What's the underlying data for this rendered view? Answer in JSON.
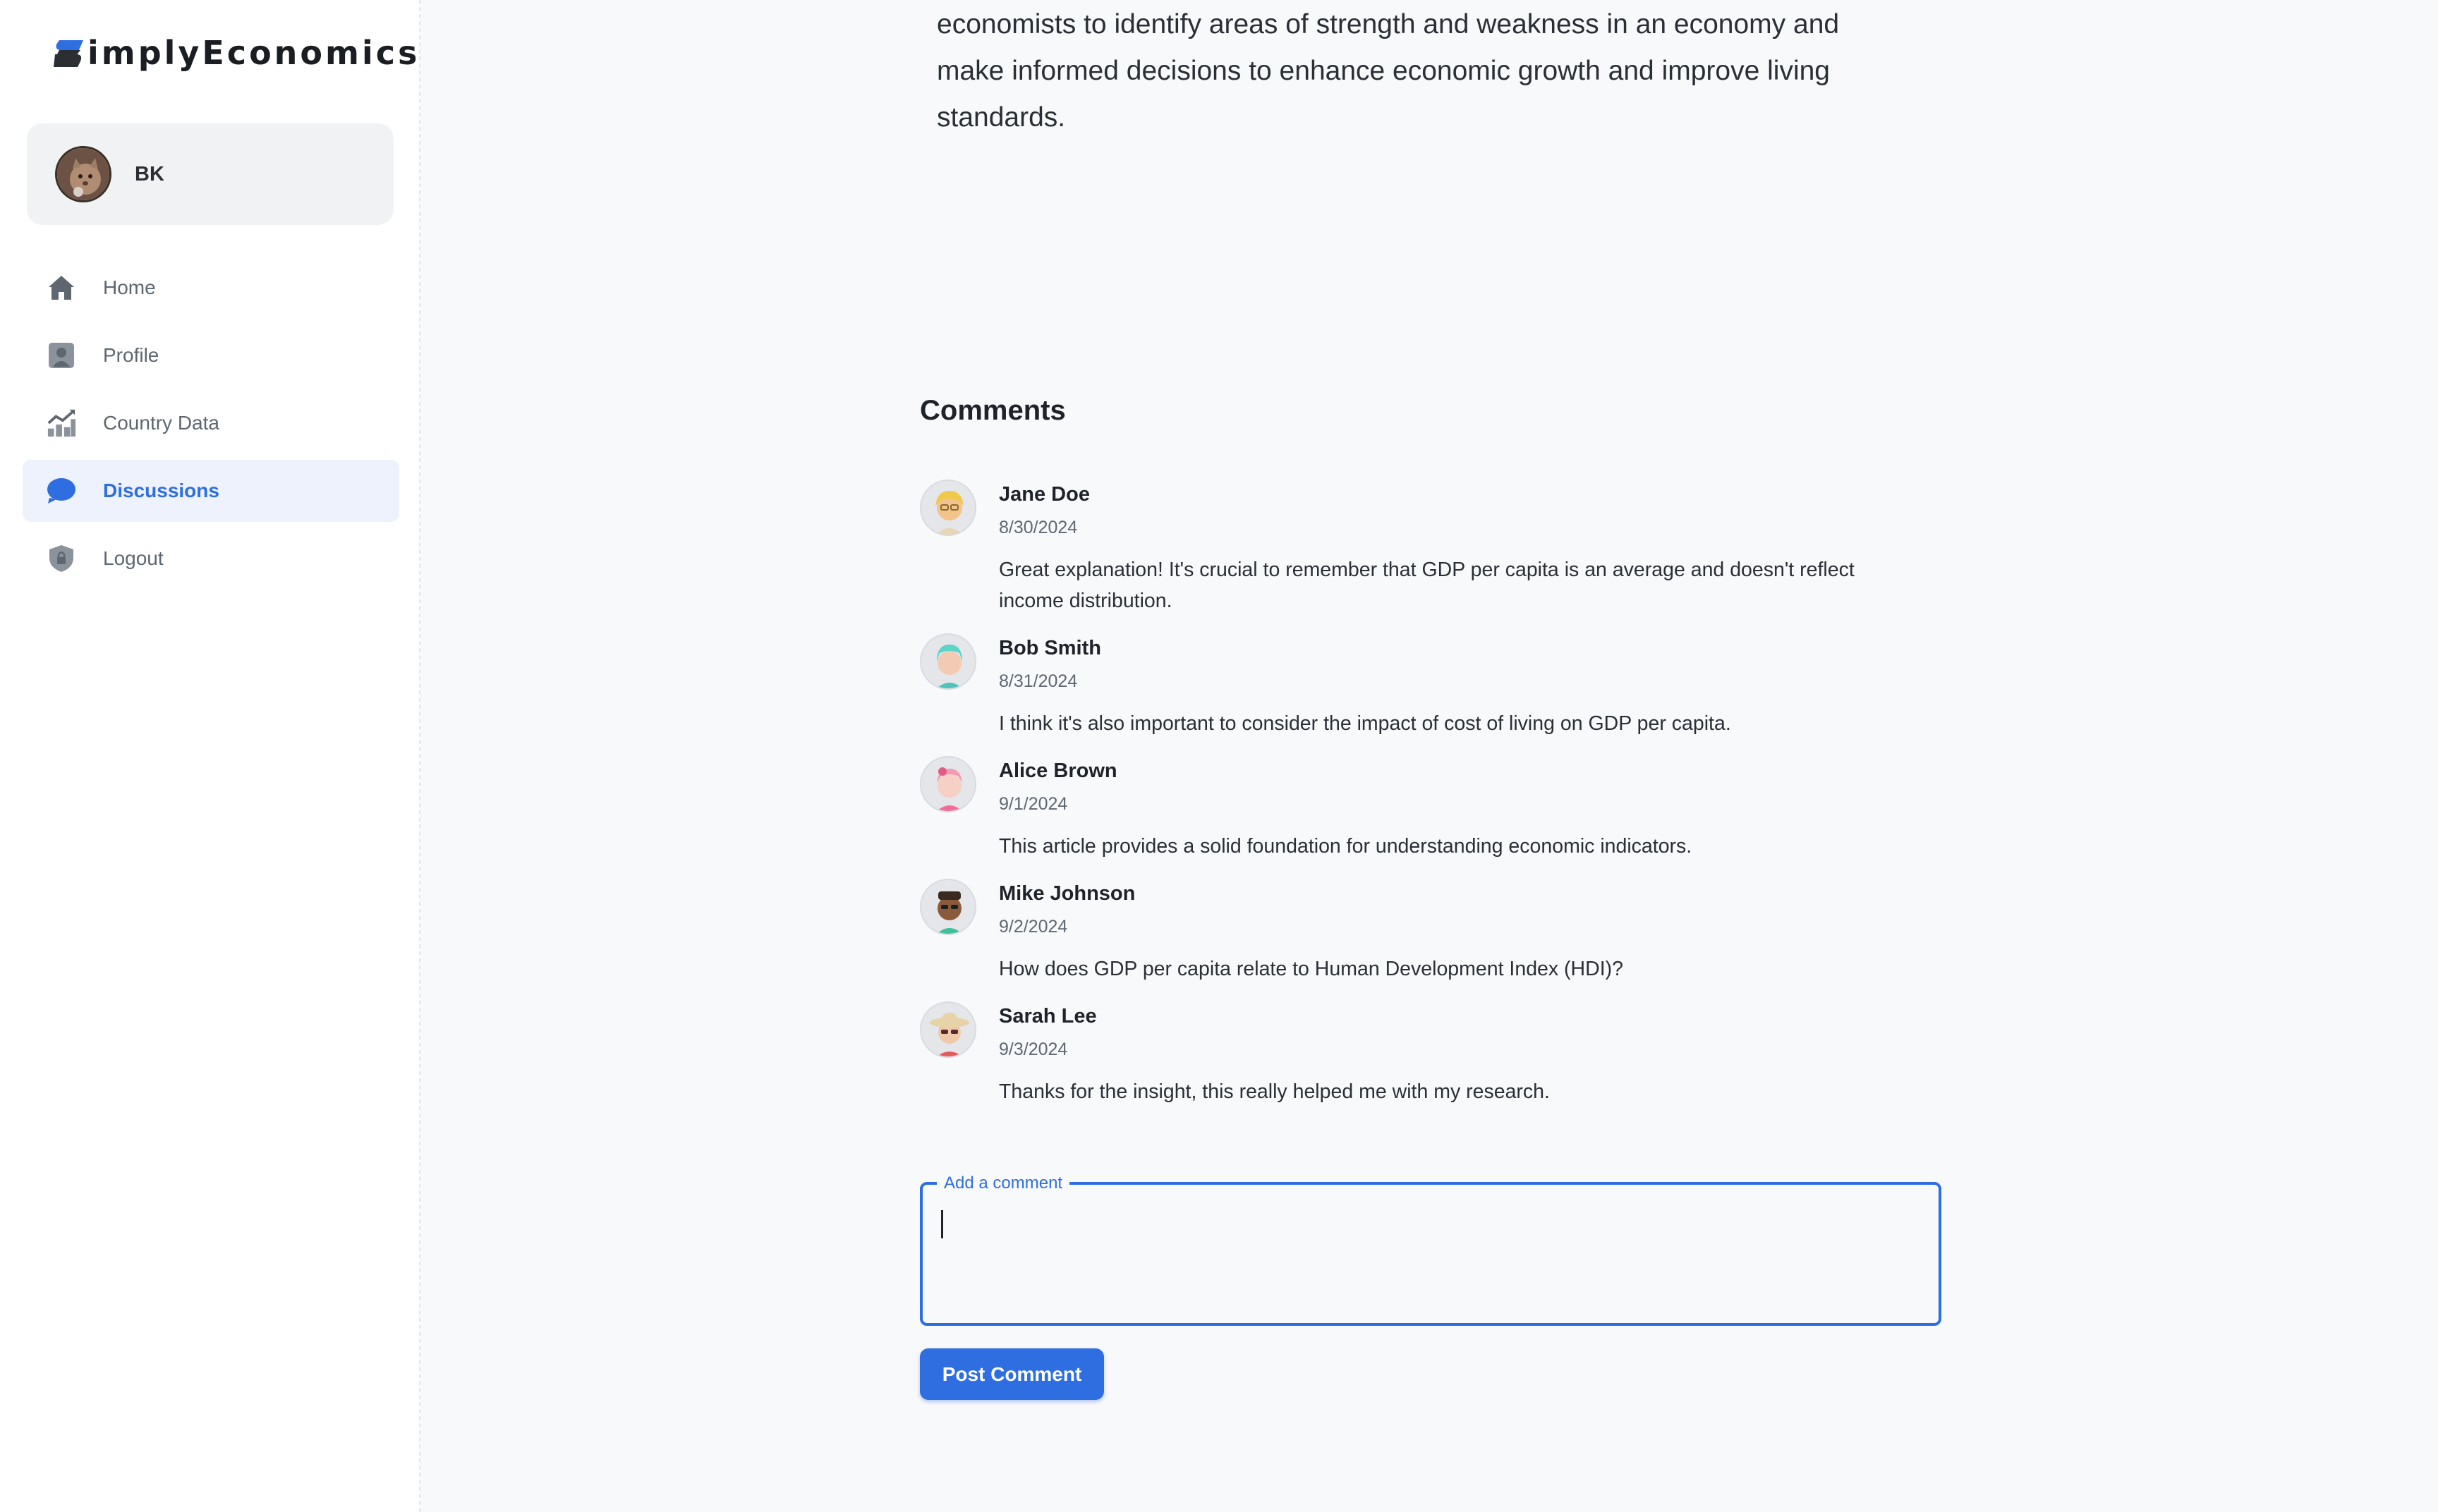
{
  "app": {
    "logo_text": "implyEconomics",
    "accent_color": "#2f6ee0"
  },
  "user": {
    "name": "BK"
  },
  "nav": {
    "items": [
      {
        "label": "Home",
        "icon": "home-icon",
        "active": false
      },
      {
        "label": "Profile",
        "icon": "profile-icon",
        "active": false
      },
      {
        "label": "Country Data",
        "icon": "chart-icon",
        "active": false
      },
      {
        "label": "Discussions",
        "icon": "chat-bubble-icon",
        "active": true
      },
      {
        "label": "Logout",
        "icon": "shield-lock-icon",
        "active": false
      }
    ]
  },
  "article": {
    "tail_lines": [
      "economists to identify areas of strength and weakness in an economy and",
      "make informed decisions to enhance economic growth and improve living",
      "standards."
    ]
  },
  "comments": {
    "title": "Comments",
    "items": [
      {
        "author": "Jane Doe",
        "date": "8/30/2024",
        "text": "Great explanation! It's crucial to remember that GDP per capita is an average and doesn't reflect income distribution."
      },
      {
        "author": "Bob Smith",
        "date": "8/31/2024",
        "text": "I think it's also important to consider the impact of cost of living on GDP per capita."
      },
      {
        "author": "Alice Brown",
        "date": "9/1/2024",
        "text": "This article provides a solid foundation for understanding economic indicators."
      },
      {
        "author": "Mike Johnson",
        "date": "9/2/2024",
        "text": "How does GDP per capita relate to Human Development Index (HDI)?"
      },
      {
        "author": "Sarah Lee",
        "date": "9/3/2024",
        "text": "Thanks for the insight, this really helped me with my research."
      }
    ]
  },
  "comment_form": {
    "label": "Add a comment",
    "value": "",
    "submit_label": "Post Comment"
  }
}
